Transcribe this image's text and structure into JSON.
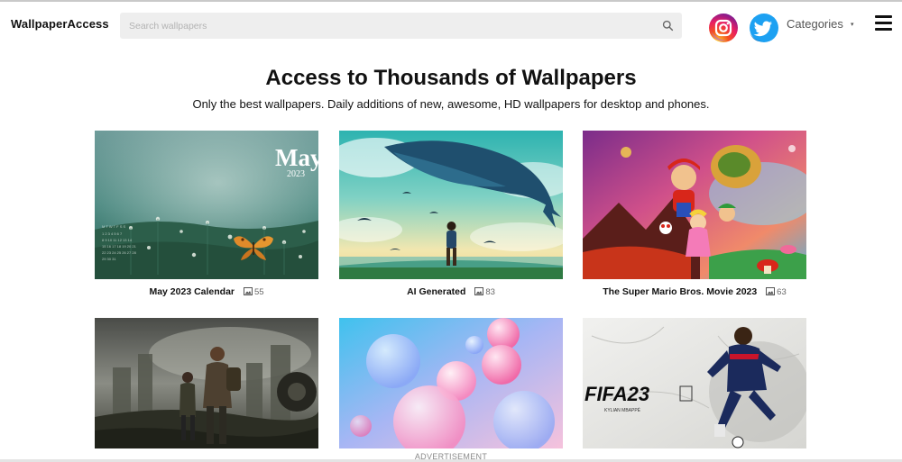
{
  "header": {
    "brand": "WallpaperAccess",
    "search_placeholder": "Search wallpapers",
    "categories_label": "Categories",
    "caret": "▾"
  },
  "hero": {
    "title": "Access to Thousands of Wallpapers",
    "subtitle": "Only the best wallpapers. Daily additions of new, awesome, HD wallpapers for desktop and phones."
  },
  "cards": [
    {
      "name": "May 2023 Calendar",
      "count": "55",
      "overlay_month": "May",
      "overlay_year": "2023"
    },
    {
      "name": "AI Generated",
      "count": "83"
    },
    {
      "name": "The Super Mario Bros. Movie 2023",
      "count": "63"
    },
    {
      "name": "",
      "count": ""
    },
    {
      "name": "",
      "count": ""
    },
    {
      "name": "",
      "count": "",
      "overlay_title": "FIFA23",
      "overlay_sub": "KYLIAN MBAPPÉ"
    }
  ],
  "ad_label": "ADVERTISEMENT",
  "icons": {
    "search": "search-icon",
    "instagram": "instagram-icon",
    "twitter": "twitter-icon",
    "menu": "hamburger-menu-icon",
    "image_count": "image-icon"
  },
  "colors": {
    "search_bg": "#eeeeee",
    "instagram_gradient": [
      "#f9a825",
      "#e91e63",
      "#7b1fa2"
    ],
    "twitter_blue": "#1da1f2"
  }
}
